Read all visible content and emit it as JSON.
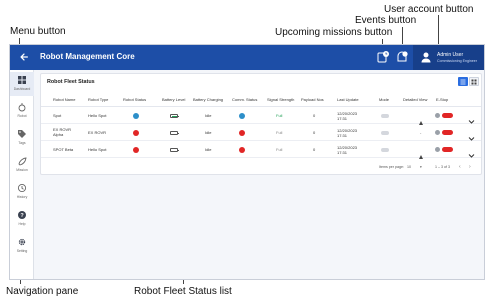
{
  "callouts": {
    "menu_button": "Menu button",
    "upcoming_missions": "Upcoming missions button",
    "events": "Events button",
    "user_account": "User account button",
    "navigation_pane": "Navigation pane",
    "fleet_list": "Robot Fleet Status list"
  },
  "header": {
    "title": "Robot Management Core",
    "user_name": "Admin User",
    "user_role": "Commissioning Engineer"
  },
  "sidebar": {
    "items": [
      {
        "label": "Dashboard",
        "icon": "dashboard-icon"
      },
      {
        "label": "Robot",
        "icon": "robot-icon"
      },
      {
        "label": "Tags",
        "icon": "tag-icon"
      },
      {
        "label": "Mission",
        "icon": "mission-icon"
      },
      {
        "label": "History",
        "icon": "history-icon"
      },
      {
        "label": "Help",
        "icon": "help-icon"
      },
      {
        "label": "Setting",
        "icon": "gear-icon"
      }
    ]
  },
  "fleet": {
    "title": "Robot Fleet Status",
    "columns": [
      "Robot Name",
      "Robot Type",
      "Robot Status",
      "Battery Level",
      "Battery Charging",
      "Comm. Status",
      "Signal Strength",
      "Payload Nos",
      "Last Update",
      "Mode",
      "Detailed View",
      "E-Stop"
    ],
    "rows": [
      {
        "name": "Spot",
        "type": "Hello Spot",
        "status": "ok",
        "battery": "high",
        "charging": "Idle",
        "comm": "ok",
        "signal": "Full",
        "payload": "0",
        "last_update": "12/20/2023 17:31",
        "estop": "ok"
      },
      {
        "name": "EX ROVR Alpha",
        "type": "EX ROVR",
        "status": "error",
        "battery": "empty",
        "charging": "Idle",
        "comm": "error",
        "signal": "Full",
        "payload": "0",
        "last_update": "12/20/2023 17:31",
        "estop": "ok"
      },
      {
        "name": "SPOT Beta",
        "type": "Hello Spot",
        "status": "error",
        "battery": "empty",
        "charging": "Idle",
        "comm": "error",
        "signal": "Full",
        "payload": "0",
        "last_update": "12/20/2023 17:31",
        "estop": "ok"
      }
    ],
    "pager": {
      "items_per_page_label": "Items per page:",
      "items_per_page": "10",
      "range": "1 – 3 of 3"
    }
  },
  "colors": {
    "header_blue": "#1d4ea7",
    "status_ok": "#2d8fc9",
    "status_error": "#e12626"
  }
}
